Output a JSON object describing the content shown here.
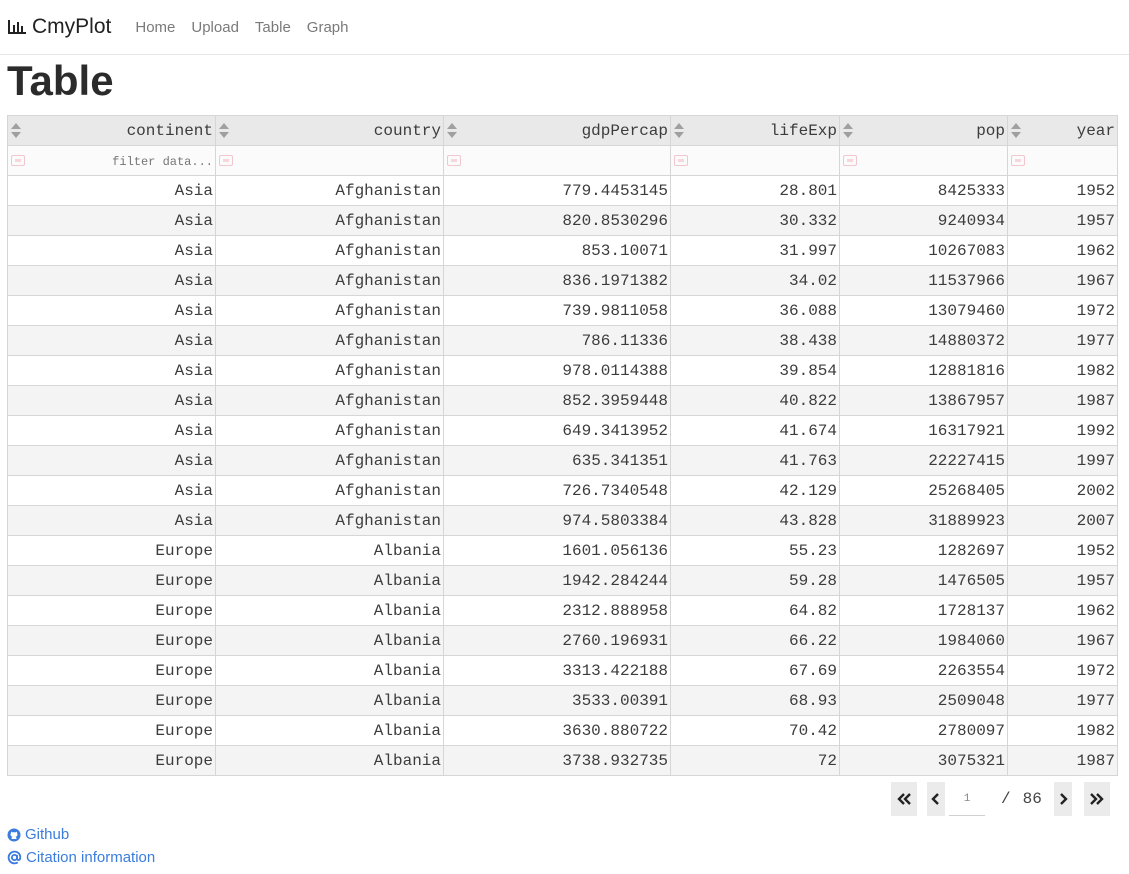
{
  "nav": {
    "brand": "CmyPlot",
    "links": [
      "Home",
      "Upload",
      "Table",
      "Graph"
    ]
  },
  "page": {
    "title": "Table"
  },
  "table": {
    "columns": [
      "continent",
      "country",
      "gdpPercap",
      "lifeExp",
      "pop",
      "year"
    ],
    "filter_placeholder": "filter data...",
    "rows": [
      [
        "Asia",
        "Afghanistan",
        "779.4453145",
        "28.801",
        "8425333",
        "1952"
      ],
      [
        "Asia",
        "Afghanistan",
        "820.8530296",
        "30.332",
        "9240934",
        "1957"
      ],
      [
        "Asia",
        "Afghanistan",
        "853.10071",
        "31.997",
        "10267083",
        "1962"
      ],
      [
        "Asia",
        "Afghanistan",
        "836.1971382",
        "34.02",
        "11537966",
        "1967"
      ],
      [
        "Asia",
        "Afghanistan",
        "739.9811058",
        "36.088",
        "13079460",
        "1972"
      ],
      [
        "Asia",
        "Afghanistan",
        "786.11336",
        "38.438",
        "14880372",
        "1977"
      ],
      [
        "Asia",
        "Afghanistan",
        "978.0114388",
        "39.854",
        "12881816",
        "1982"
      ],
      [
        "Asia",
        "Afghanistan",
        "852.3959448",
        "40.822",
        "13867957",
        "1987"
      ],
      [
        "Asia",
        "Afghanistan",
        "649.3413952",
        "41.674",
        "16317921",
        "1992"
      ],
      [
        "Asia",
        "Afghanistan",
        "635.341351",
        "41.763",
        "22227415",
        "1997"
      ],
      [
        "Asia",
        "Afghanistan",
        "726.7340548",
        "42.129",
        "25268405",
        "2002"
      ],
      [
        "Asia",
        "Afghanistan",
        "974.5803384",
        "43.828",
        "31889923",
        "2007"
      ],
      [
        "Europe",
        "Albania",
        "1601.056136",
        "55.23",
        "1282697",
        "1952"
      ],
      [
        "Europe",
        "Albania",
        "1942.284244",
        "59.28",
        "1476505",
        "1957"
      ],
      [
        "Europe",
        "Albania",
        "2312.888958",
        "64.82",
        "1728137",
        "1962"
      ],
      [
        "Europe",
        "Albania",
        "2760.196931",
        "66.22",
        "1984060",
        "1967"
      ],
      [
        "Europe",
        "Albania",
        "3313.422188",
        "67.69",
        "2263554",
        "1972"
      ],
      [
        "Europe",
        "Albania",
        "3533.00391",
        "68.93",
        "2509048",
        "1977"
      ],
      [
        "Europe",
        "Albania",
        "3630.880722",
        "70.42",
        "2780097",
        "1982"
      ],
      [
        "Europe",
        "Albania",
        "3738.932735",
        "72",
        "3075321",
        "1987"
      ]
    ]
  },
  "pagination": {
    "current": "1",
    "separator": "/",
    "total": "86"
  },
  "footer": {
    "github": "Github",
    "citation": "Citation information"
  },
  "colors": {
    "link": "#3b7ddd",
    "header_bg": "#e9e9e9",
    "stripe": "#f4f4f4"
  }
}
